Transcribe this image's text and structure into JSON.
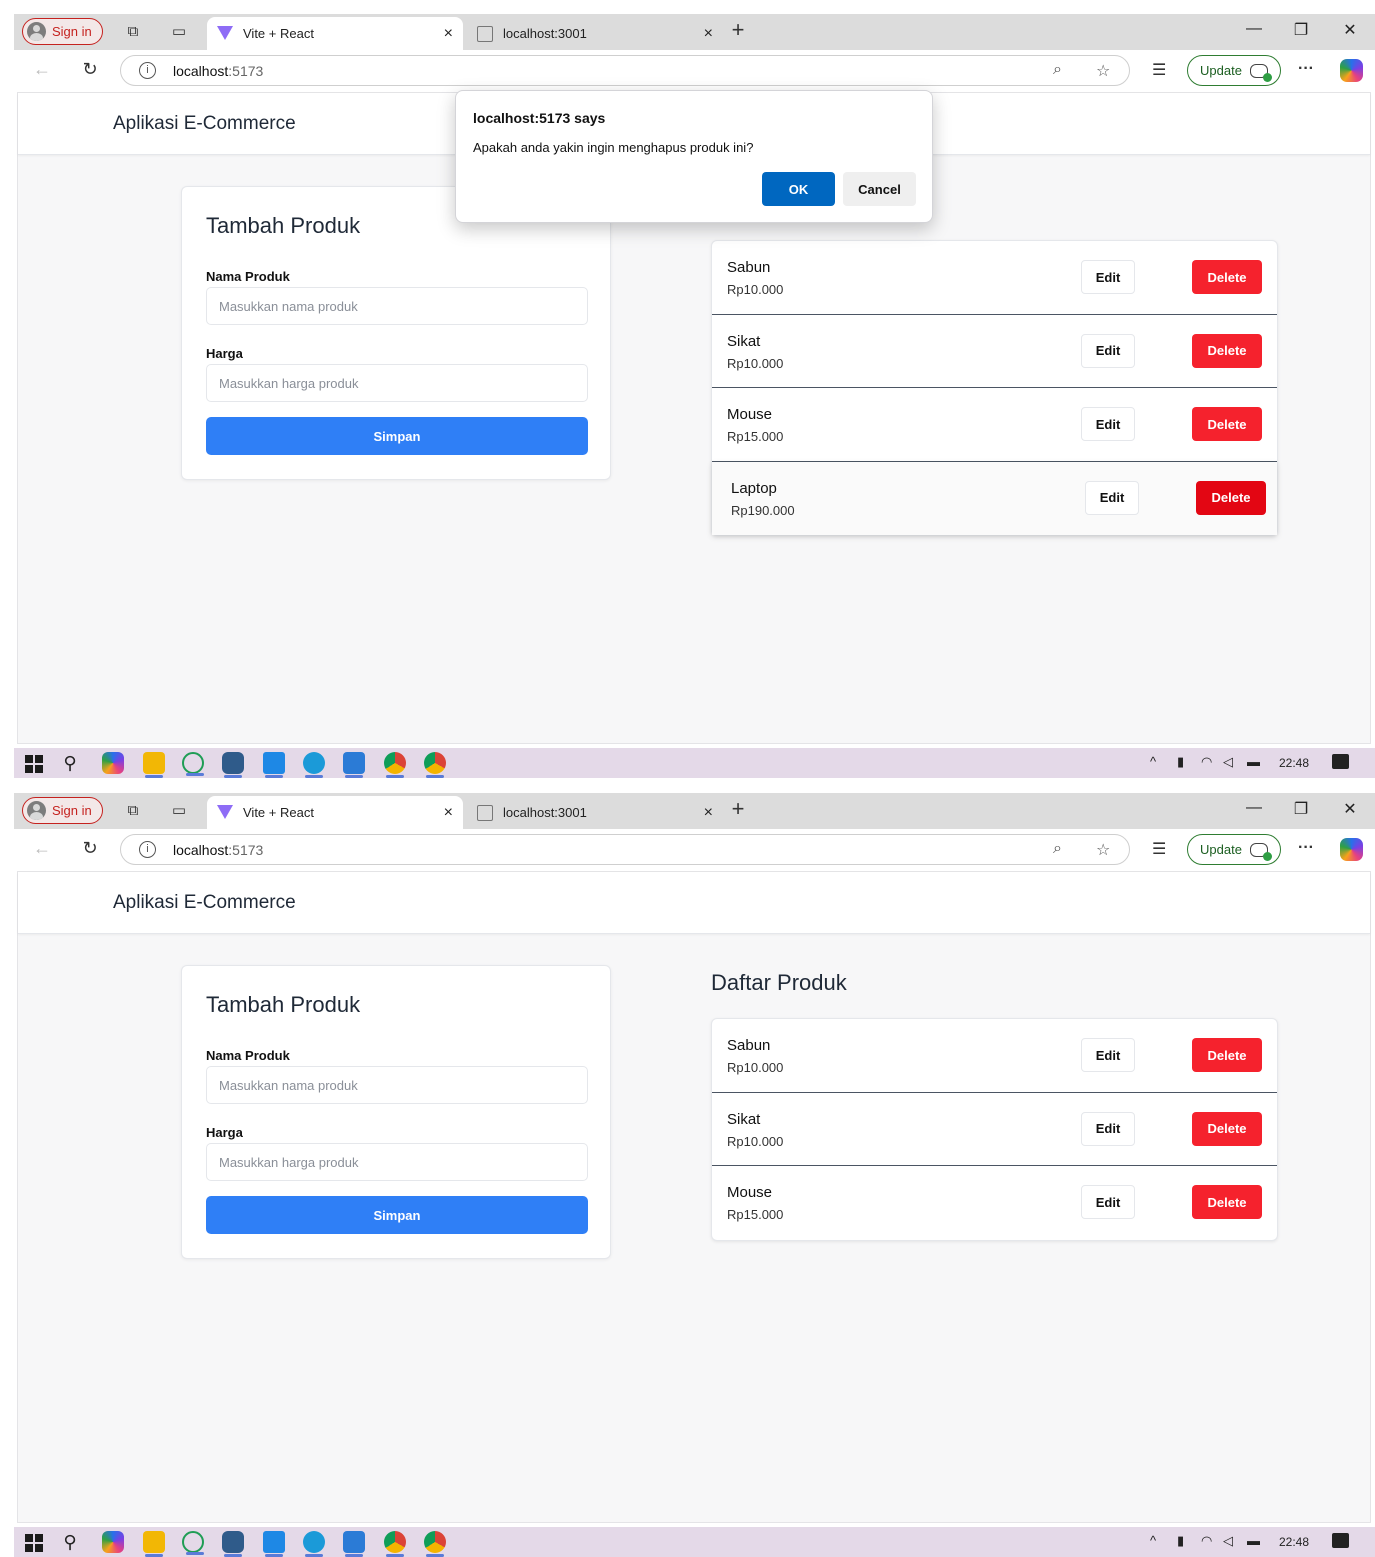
{
  "screens": [
    {
      "browser": {
        "signin_label": "Sign in",
        "tabs": [
          {
            "title": "Vite + React",
            "active": true,
            "close": "×"
          },
          {
            "title": "localhost:3001",
            "active": false,
            "close": "×"
          }
        ],
        "new_tab": "+",
        "url_host": "localhost",
        "url_port": ":5173",
        "update_label": "Update",
        "more_label": "···"
      },
      "app": {
        "title": "Aplikasi E-Commerce",
        "form": {
          "title": "Tambah Produk",
          "name_label": "Nama Produk",
          "name_placeholder": "Masukkan nama produk",
          "price_label": "Harga",
          "price_placeholder": "Masukkan harga produk",
          "submit_label": "Simpan"
        },
        "list": {
          "title": "",
          "edit_label": "Edit",
          "delete_label": "Delete",
          "products": [
            {
              "name": "Sabun",
              "price": "Rp10.000"
            },
            {
              "name": "Sikat",
              "price": "Rp10.000"
            },
            {
              "name": "Mouse",
              "price": "Rp15.000"
            },
            {
              "name": "Laptop",
              "price": "Rp190.000"
            }
          ]
        }
      },
      "dialog": {
        "title": "localhost:5173 says",
        "message": "Apakah anda yakin ingin menghapus produk ini?",
        "ok_label": "OK",
        "cancel_label": "Cancel"
      },
      "taskbar": {
        "time": "22:48"
      }
    },
    {
      "browser": {
        "signin_label": "Sign in",
        "tabs": [
          {
            "title": "Vite + React",
            "active": true,
            "close": "×"
          },
          {
            "title": "localhost:3001",
            "active": false,
            "close": "×"
          }
        ],
        "new_tab": "+",
        "url_host": "localhost",
        "url_port": ":5173",
        "update_label": "Update",
        "more_label": "···"
      },
      "app": {
        "title": "Aplikasi E-Commerce",
        "form": {
          "title": "Tambah Produk",
          "name_label": "Nama Produk",
          "name_placeholder": "Masukkan nama produk",
          "price_label": "Harga",
          "price_placeholder": "Masukkan harga produk",
          "submit_label": "Simpan"
        },
        "list": {
          "title": "Daftar Produk",
          "edit_label": "Edit",
          "delete_label": "Delete",
          "products": [
            {
              "name": "Sabun",
              "price": "Rp10.000"
            },
            {
              "name": "Sikat",
              "price": "Rp10.000"
            },
            {
              "name": "Mouse",
              "price": "Rp15.000"
            }
          ]
        }
      },
      "taskbar": {
        "time": "22:48"
      }
    }
  ],
  "colors": {
    "primary_button": "#2f7ff6",
    "delete_button": "#f5222d",
    "dialog_ok": "#0067c0",
    "taskbar": "#e4d9e8"
  },
  "icons": {
    "browser": [
      "profile-icon",
      "workspaces-icon",
      "tab-actions-icon",
      "vite-favicon-icon",
      "page-favicon-icon",
      "back-icon",
      "refresh-icon",
      "site-info-icon",
      "zoom-icon",
      "favorite-star-icon",
      "favorites-icon",
      "update-heart-icon",
      "copilot-icon"
    ],
    "taskbar": [
      "windows-start-icon",
      "search-icon",
      "copilot-icon",
      "file-explorer-icon",
      "whatsapp-icon",
      "postgres-icon",
      "vscode-icon",
      "edge-icon",
      "photos-icon",
      "chrome-icon",
      "chrome-icon",
      "chevron-up-icon",
      "usb-icon",
      "wifi-icon",
      "volume-icon",
      "battery-icon",
      "notification-icon"
    ]
  }
}
